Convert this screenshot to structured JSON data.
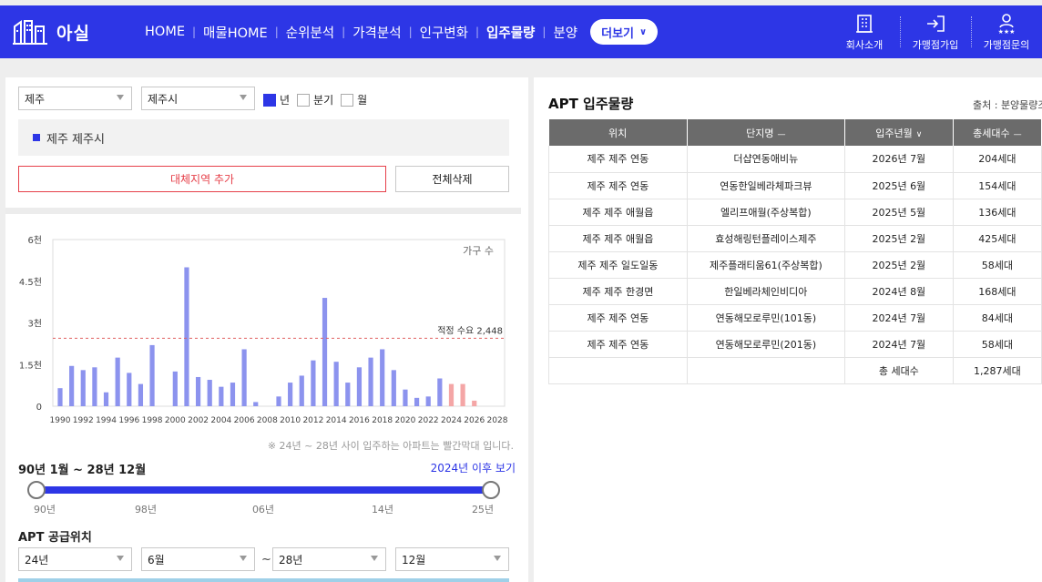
{
  "header": {
    "logo_text": "아실",
    "nav": [
      "HOME",
      "매물HOME",
      "순위분석",
      "가격분석",
      "인구변화",
      "입주물량",
      "분양"
    ],
    "active_nav": "입주물량",
    "more_label": "더보기",
    "right_menu": [
      {
        "label": "회사소개",
        "icon": "building-icon"
      },
      {
        "label": "가맹점가입",
        "icon": "sign-in-icon"
      },
      {
        "label": "가맹점문의",
        "icon": "user-stars-icon"
      }
    ]
  },
  "filters": {
    "region1": "제주",
    "region2": "제주시",
    "period_options": [
      {
        "label": "년",
        "checked": true
      },
      {
        "label": "분기",
        "checked": false
      },
      {
        "label": "월",
        "checked": false
      }
    ]
  },
  "selected_region": "제주 제주시",
  "buttons": {
    "add_alternative": "대체지역 추가",
    "delete_all": "전체삭제"
  },
  "chart_data": {
    "type": "bar",
    "legend_label": "가구 수",
    "y_ticks": [
      "6천",
      "4.5천",
      "3천",
      "1.5천",
      "0"
    ],
    "ylim": [
      0,
      6000
    ],
    "x_tick_labels": [
      "1990",
      "1992",
      "1994",
      "1996",
      "1998",
      "2000",
      "2002",
      "2004",
      "2006",
      "2008",
      "2010",
      "2012",
      "2014",
      "2016",
      "2018",
      "2020",
      "2022",
      "2024",
      "2026",
      "2028"
    ],
    "categories": [
      1990,
      1991,
      1992,
      1993,
      1994,
      1995,
      1996,
      1997,
      1998,
      1999,
      2000,
      2001,
      2002,
      2003,
      2004,
      2005,
      2006,
      2007,
      2008,
      2009,
      2010,
      2011,
      2012,
      2013,
      2014,
      2015,
      2016,
      2017,
      2018,
      2019,
      2020,
      2021,
      2022,
      2023,
      2024,
      2025,
      2026,
      2027,
      2028
    ],
    "values": [
      650,
      1450,
      1300,
      1400,
      500,
      1750,
      1200,
      800,
      2200,
      0,
      1250,
      5000,
      1050,
      950,
      700,
      850,
      2050,
      150,
      0,
      350,
      850,
      1100,
      1650,
      3900,
      1600,
      850,
      1400,
      1750,
      2050,
      1300,
      600,
      300,
      350,
      1000,
      800,
      800,
      200,
      0,
      0
    ],
    "highlight_start_year": 2024,
    "colors": {
      "normal": "#8c93ee",
      "future": "#f4a6a6",
      "reference": "#e06060"
    },
    "reference_line": {
      "value": 2448,
      "label": "적정 수요 2,448"
    }
  },
  "chart_note": "※ 24년 ~ 28년 사이 입주하는 아파트는 빨간막대 입니다.",
  "range": {
    "label": "90년 1월 ~ 28년 12월",
    "after_link": "2024년 이후 보기",
    "ticks": [
      "90년",
      "98년",
      "06년",
      "14년",
      "25년"
    ]
  },
  "supply": {
    "title": "APT 공급위치",
    "from_year": "24년",
    "from_month": "6월",
    "tilde": "~",
    "to_year": "28년",
    "to_month": "12월"
  },
  "apt": {
    "title": "APT 입주물량",
    "source": "출처 : 분양물량조",
    "columns": [
      {
        "label": "위치",
        "arrow": ""
      },
      {
        "label": "단지명",
        "arrow": "—"
      },
      {
        "label": "입주년월",
        "arrow": "∨"
      },
      {
        "label": "총세대수",
        "arrow": "—"
      }
    ],
    "rows": [
      [
        "제주 제주 연동",
        "더샵연동애비뉴",
        "2026년 7월",
        "204세대"
      ],
      [
        "제주 제주 연동",
        "연동한일베라체파크뷰",
        "2025년 6월",
        "154세대"
      ],
      [
        "제주 제주 애월읍",
        "엘리프애월(주상복합)",
        "2025년 5월",
        "136세대"
      ],
      [
        "제주 제주 애월읍",
        "효성해링턴플레이스제주",
        "2025년 2월",
        "425세대"
      ],
      [
        "제주 제주 일도일동",
        "제주플래티움61(주상복합)",
        "2025년 2월",
        "58세대"
      ],
      [
        "제주 제주 한경면",
        "한일베라체인비디아",
        "2024년 8월",
        "168세대"
      ],
      [
        "제주 제주 연동",
        "연동해모로루민(101동)",
        "2024년 7월",
        "84세대"
      ],
      [
        "제주 제주 연동",
        "연동해모로루민(201동)",
        "2024년 7월",
        "58세대"
      ]
    ],
    "total_label": "총 세대수",
    "total_value": "1,287세대"
  }
}
